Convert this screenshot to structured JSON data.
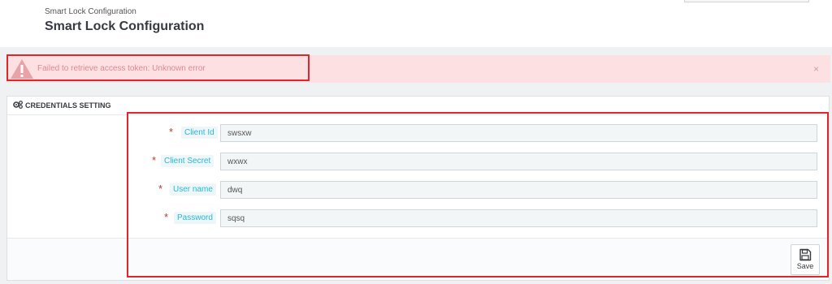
{
  "header": {
    "breadcrumb": "Smart Lock Configuration",
    "title": "Smart Lock Configuration"
  },
  "alert": {
    "message": "Failed to retrieve access token: Unknown error",
    "close": "×"
  },
  "panel": {
    "heading": "CREDENTIALS SETTING",
    "fields": [
      {
        "required": "*",
        "label": "Client Id",
        "value": "swsxw"
      },
      {
        "required": "*",
        "label": "Client Secret",
        "value": "wxwx"
      },
      {
        "required": "*",
        "label": "User name",
        "value": "dwq"
      },
      {
        "required": "*",
        "label": "Password",
        "value": "sqsq"
      }
    ],
    "save_label": "Save"
  },
  "colors": {
    "accent": "#25b9d7",
    "error_bg": "#fde0e1",
    "error_text": "#dc8a90",
    "highlight": "#e0262b"
  }
}
